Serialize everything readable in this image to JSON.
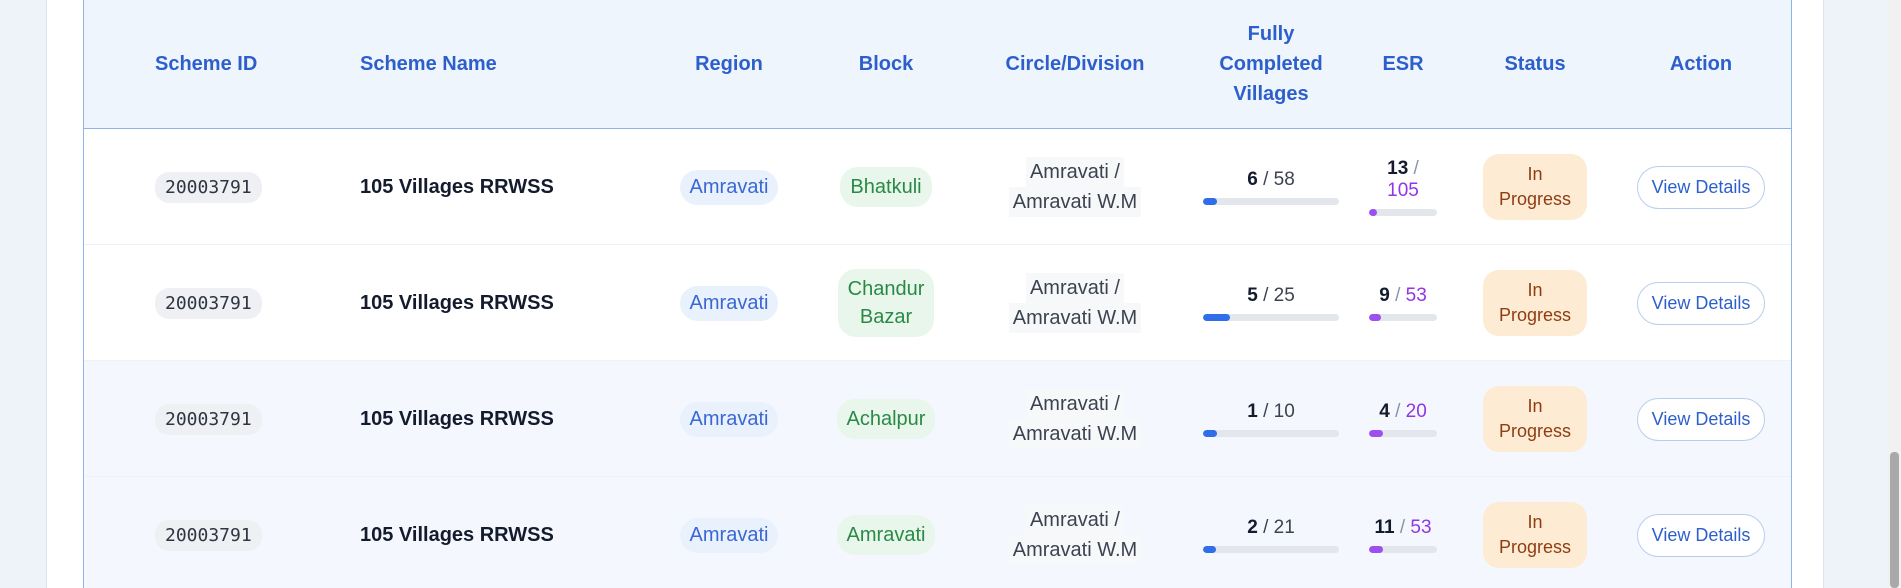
{
  "table": {
    "headers": {
      "scheme_id": "Scheme ID",
      "scheme_name": "Scheme Name",
      "region": "Region",
      "block": "Block",
      "circle_division": "Circle/Division",
      "fully_completed_l1": "Fully",
      "fully_completed_l2": "Completed",
      "fully_completed_l3": "Villages",
      "esr": "ESR",
      "status": "Status",
      "action": "Action"
    },
    "rows": [
      {
        "scheme_id": "20003791",
        "scheme_name": "105 Villages RRWSS",
        "region": "Amravati",
        "block_l1": "Bhatkuli",
        "block_l2": "",
        "circle_l1": "Amravati /",
        "circle_l2": "Amravati W.M",
        "villages_done": "6",
        "villages_total": "58",
        "villages_progress": 0.103,
        "esr_done": "13",
        "esr_total": "105",
        "esr_progress": 0.124,
        "status_l1": "In",
        "status_l2": "Progress",
        "action": "View Details"
      },
      {
        "scheme_id": "20003791",
        "scheme_name": "105 Villages RRWSS",
        "region": "Amravati",
        "block_l1": "Chandur",
        "block_l2": "Bazar",
        "circle_l1": "Amravati /",
        "circle_l2": "Amravati W.M",
        "villages_done": "5",
        "villages_total": "25",
        "villages_progress": 0.2,
        "esr_done": "9",
        "esr_total": "53",
        "esr_progress": 0.17,
        "status_l1": "In",
        "status_l2": "Progress",
        "action": "View Details"
      },
      {
        "scheme_id": "20003791",
        "scheme_name": "105 Villages RRWSS",
        "region": "Amravati",
        "block_l1": "Achalpur",
        "block_l2": "",
        "circle_l1": "Amravati /",
        "circle_l2": "Amravati W.M",
        "villages_done": "1",
        "villages_total": "10",
        "villages_progress": 0.1,
        "esr_done": "4",
        "esr_total": "20",
        "esr_progress": 0.2,
        "status_l1": "In",
        "status_l2": "Progress",
        "action": "View Details"
      },
      {
        "scheme_id": "20003791",
        "scheme_name": "105 Villages RRWSS",
        "region": "Amravati",
        "block_l1": "Amravati",
        "block_l2": "",
        "circle_l1": "Amravati /",
        "circle_l2": "Amravati W.M",
        "villages_done": "2",
        "villages_total": "21",
        "villages_progress": 0.095,
        "esr_done": "11",
        "esr_total": "53",
        "esr_progress": 0.208,
        "status_l1": "In",
        "status_l2": "Progress",
        "action": "View Details"
      }
    ]
  },
  "colors": {
    "header_text": "#2d5fcc",
    "village_bar": "#2f6ee8",
    "esr_bar": "#9d4ff0",
    "status_bg": "#fdebd3",
    "status_text": "#8f3d12"
  }
}
